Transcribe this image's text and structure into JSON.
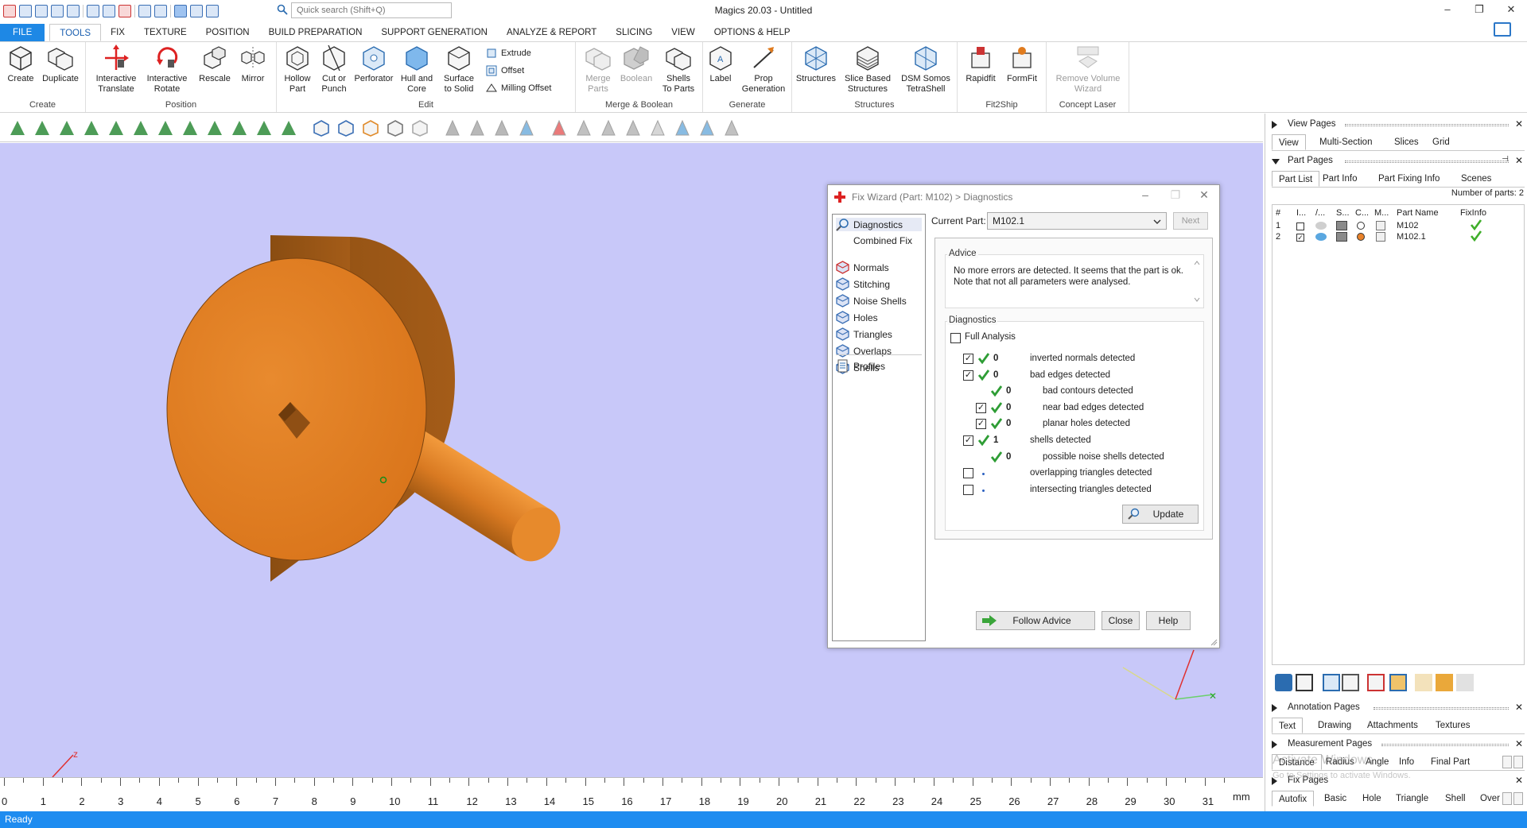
{
  "app": {
    "title": "Magics 20.03 - Untitled",
    "search_placeholder": "Quick search (Shift+Q)",
    "status": "Ready",
    "window_buttons": [
      "–",
      "❐",
      "✕"
    ]
  },
  "ribbon_tabs": [
    {
      "label": "FILE"
    },
    {
      "label": "TOOLS",
      "active": true
    },
    {
      "label": "FIX"
    },
    {
      "label": "TEXTURE"
    },
    {
      "label": "POSITION"
    },
    {
      "label": "BUILD PREPARATION"
    },
    {
      "label": "SUPPORT GENERATION"
    },
    {
      "label": "ANALYZE & REPORT"
    },
    {
      "label": "SLICING"
    },
    {
      "label": "VIEW"
    },
    {
      "label": "OPTIONS & HELP"
    }
  ],
  "ribbon": {
    "groups": [
      {
        "label": "Create",
        "buttons": [
          "Create",
          "Duplicate"
        ]
      },
      {
        "label": "Position",
        "buttons": [
          "Interactive\nTranslate",
          "Interactive\nRotate",
          "Rescale",
          "Mirror"
        ]
      },
      {
        "label": "Edit",
        "buttons": [
          "Hollow\nPart",
          "Cut or\nPunch",
          "Perforator",
          "Hull and\nCore",
          "Surface\nto Solid"
        ],
        "small": [
          "Extrude",
          "Offset",
          "Milling Offset"
        ]
      },
      {
        "label": "Merge & Boolean",
        "buttons": [
          "Merge\nParts",
          "Boolean",
          "Shells\nTo Parts"
        ]
      },
      {
        "label": "Generate",
        "buttons": [
          "Label",
          "Prop\nGeneration"
        ]
      },
      {
        "label": "Structures",
        "buttons": [
          "Structures",
          "Slice Based\nStructures",
          "DSM Somos\nTetraShell"
        ]
      },
      {
        "label": "Fit2Ship",
        "buttons": [
          "Rapidfit",
          "FormFit"
        ]
      },
      {
        "label": "Concept Laser",
        "buttons": [
          "Remove Volume\nWizard"
        ]
      }
    ]
  },
  "ruler": {
    "unit": "mm",
    "ticks": [
      "0",
      "1",
      "2",
      "3",
      "4",
      "5",
      "6",
      "7",
      "8",
      "9",
      "10",
      "11",
      "12",
      "13",
      "14",
      "15",
      "16",
      "17",
      "18",
      "19",
      "20",
      "21",
      "22",
      "23",
      "24",
      "25",
      "26",
      "27",
      "28",
      "29",
      "30",
      "31"
    ]
  },
  "axes": {
    "z_label": "z"
  },
  "dialog": {
    "title": "Fix Wizard (Part: M102) > Diagnostics",
    "nav_top": [
      "Diagnostics",
      "Combined Fix"
    ],
    "nav_items": [
      "Normals",
      "Stitching",
      "Noise Shells",
      "Holes",
      "Triangles",
      "Overlaps",
      "Shells"
    ],
    "nav_bottom": [
      "Profiles"
    ],
    "current_part_label": "Current Part:",
    "current_part_value": "M102.1",
    "next_label": "Next",
    "advice_legend": "Advice",
    "advice_text": "No more errors are detected. It seems that the part is ok. Note that not all parameters were analysed.",
    "diagnostics_legend": "Diagnostics",
    "full_analysis_label": "Full Analysis",
    "rows": [
      {
        "count": "0",
        "label": "inverted normals detected",
        "checked": true,
        "status": "ok",
        "indent": 0
      },
      {
        "count": "0",
        "label": "bad edges detected",
        "checked": true,
        "status": "ok",
        "indent": 0
      },
      {
        "count": "0",
        "label": "bad contours detected",
        "checked": null,
        "status": "ok",
        "indent": 1
      },
      {
        "count": "0",
        "label": "near bad edges detected",
        "checked": true,
        "status": "ok",
        "indent": 1
      },
      {
        "count": "0",
        "label": "planar holes detected",
        "checked": true,
        "status": "ok",
        "indent": 1
      },
      {
        "count": "1",
        "label": "shells detected",
        "checked": true,
        "status": "ok",
        "indent": 0
      },
      {
        "count": "0",
        "label": "possible noise shells detected",
        "checked": null,
        "status": "ok",
        "indent": 1
      },
      {
        "count": "",
        "label": "overlapping triangles detected",
        "checked": false,
        "status": "dot",
        "indent": 0
      },
      {
        "count": "",
        "label": "intersecting triangles detected",
        "checked": false,
        "status": "dot",
        "indent": 0
      }
    ],
    "update_label": "Update",
    "follow_advice_label": "Follow Advice",
    "close_label": "Close",
    "help_label": "Help"
  },
  "right_panel": {
    "view_pages": {
      "title": "View Pages",
      "tabs": [
        "View",
        "Multi-Section",
        "Slices",
        "Grid"
      ]
    },
    "part_pages": {
      "title": "Part Pages",
      "tabs": [
        "Part List",
        "Part Info",
        "Part Fixing Info",
        "Scenes"
      ],
      "count_text": "Number of parts: 2",
      "columns": [
        "#",
        "I...",
        "/...",
        "S...",
        "C...",
        "M...",
        "Part Name",
        "FixInfo"
      ],
      "rows": [
        {
          "num": "1",
          "name": "M102",
          "checked": false,
          "color": "#ffffff",
          "fixed": true
        },
        {
          "num": "2",
          "name": "M102.1",
          "checked": true,
          "color": "#e8822a",
          "fixed": true
        }
      ]
    },
    "annotation_pages": {
      "title": "Annotation Pages",
      "tabs": [
        "Text",
        "Drawing",
        "Attachments",
        "Textures"
      ]
    },
    "measurement_pages": {
      "title": "Measurement Pages",
      "tabs": [
        "Distance",
        "Radius",
        "Angle",
        "Info",
        "Final Part"
      ]
    },
    "fix_pages": {
      "title": "Fix Pages",
      "tabs": [
        "Autofix",
        "Basic",
        "Hole",
        "Triangle",
        "Shell",
        "Over"
      ]
    },
    "watermark": "Activate Windows",
    "watermark_sub": "Go to Settings to activate Windows."
  },
  "colors": {
    "viewport_bg": "#c8c8f9",
    "part_orange": "#e07b1e",
    "accent": "#1e88e5",
    "check_green": "#2e9d35"
  }
}
